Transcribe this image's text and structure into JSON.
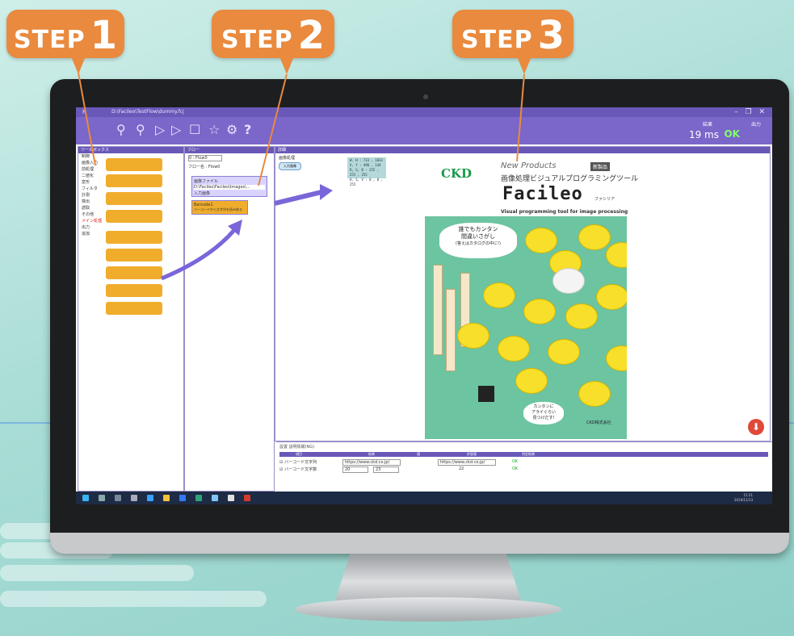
{
  "steps": [
    {
      "label": "STEP",
      "num": "1"
    },
    {
      "label": "STEP",
      "num": "2"
    },
    {
      "label": "STEP",
      "num": "3"
    }
  ],
  "window": {
    "title": "F",
    "path": "D:\\Facileo\\TestFlow\\dummy.fcj",
    "controls": "– ❐ ✕"
  },
  "toolbar": {
    "ms": "19 ms",
    "result_label": "結果",
    "result_value": "OK",
    "output_label": "出力"
  },
  "tool_panel": {
    "title": "ツールボックス",
    "categories": [
      "制御",
      "画像入力",
      "前処理",
      "二値化",
      "変形",
      "フィルタ",
      "計測",
      "検出",
      "読取",
      "その他",
      "メイン処理",
      "出力",
      "追加"
    ]
  },
  "flow_panel": {
    "title": "フロー",
    "selector": "0 : Flow0",
    "name_label": "フロー名 : Flow0",
    "input_title": "画像ファイル",
    "input_path": "D:\\Facileo\\Facileo\\Images\\...",
    "input_sub": "入力画像",
    "barcode_title": "Barcode1",
    "barcode_sub": "バーコードから文字列を読み取る"
  },
  "detail": {
    "title": "詳細",
    "image_label": "画像処理",
    "input_btn": "入力画像",
    "info": [
      "W, H : 733 , 1033",
      "X, Y : 490 , 144",
      "R, G, B : 255 , 255 , 255",
      "H, S, V : 0 , 0 , 255"
    ]
  },
  "poster": {
    "brand": "CKD",
    "new_products": "New Products",
    "badge": "新製品",
    "jp_title": "画像処理ビジュアルプログラミングツール",
    "product": "Facileo",
    "product_kana": "ファシリア",
    "english": "Visual programming tool for image processing",
    "cloud": [
      "誰でもカンタン",
      "間違いさがし",
      "(答えはカタログの中に!)"
    ],
    "bubble2": [
      "カンタンに",
      "アライぐらい",
      "見つけだす!"
    ],
    "footer": "CKD株式会社"
  },
  "bottom": {
    "tabs": "設置  説明情報(NG)",
    "headers": [
      "項目",
      "結果",
      "値",
      "許容値",
      "判定結果"
    ],
    "rows": [
      {
        "name": "バーコード文字列",
        "result": "https://www.ckd.co.jp/",
        "val": "https://www.ckd.co.jp/",
        "judge": "OK"
      },
      {
        "name": "バーコード文字数",
        "result": "20",
        "result2": "23",
        "val": "22",
        "judge": "OK"
      }
    ]
  },
  "taskbar": {
    "clock": "15:31",
    "date": "2019/11/13"
  },
  "colors": {
    "accent": "#6a58b8",
    "step": "#e98a3e",
    "ok": "#7fff6a",
    "block": "#f0ad2c"
  }
}
